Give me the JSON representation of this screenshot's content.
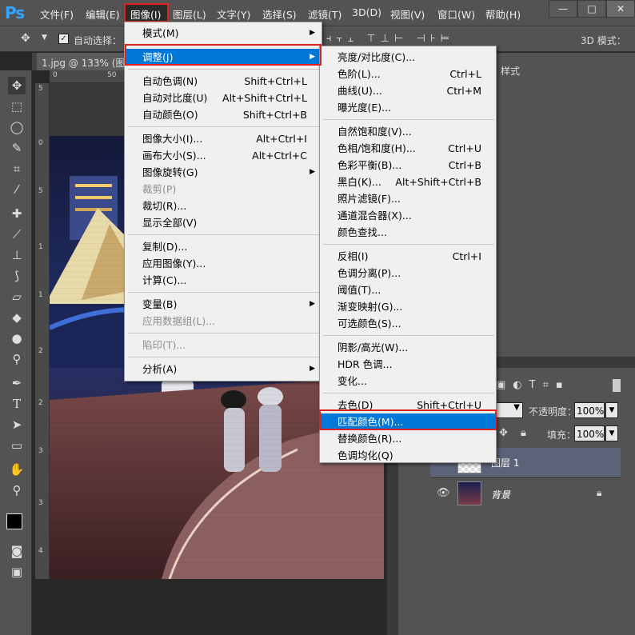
{
  "menubar": {
    "logo": "Ps",
    "items": [
      "文件(F)",
      "编辑(E)",
      "图像(I)",
      "图层(L)",
      "文字(Y)",
      "选择(S)",
      "滤镜(T)",
      "3D(D)",
      "视图(V)",
      "窗口(W)",
      "帮助(H)"
    ],
    "window_controls": [
      "—",
      "□",
      "✕"
    ]
  },
  "options": {
    "auto_select_label": "自动选择：",
    "mode_3d_label": "3D 模式："
  },
  "document": {
    "tab_title": "1.jpg @ 133% (图",
    "ruler_h": [
      "0",
      "50"
    ],
    "ruler_v": [
      "5",
      "0",
      "5",
      "1",
      "1",
      "2",
      "2",
      "3",
      "3",
      "4",
      "4"
    ]
  },
  "panels": {
    "style_tab": "样式",
    "opacity_label": "不透明度：",
    "opacity_value": "100%",
    "fill_label": "填充：",
    "fill_value": "100%",
    "layers": [
      {
        "name": "图层 1"
      },
      {
        "name": "背景"
      }
    ]
  },
  "image_menu": {
    "items": [
      {
        "label": "模式(M)",
        "shortcut": "",
        "submenu": true,
        "disabled": false
      },
      {
        "sep": true
      },
      {
        "label": "调整(J)",
        "shortcut": "",
        "submenu": true,
        "disabled": false,
        "highlighted": true
      },
      {
        "sep": true
      },
      {
        "label": "自动色调(N)",
        "shortcut": "Shift+Ctrl+L"
      },
      {
        "label": "自动对比度(U)",
        "shortcut": "Alt+Shift+Ctrl+L"
      },
      {
        "label": "自动颜色(O)",
        "shortcut": "Shift+Ctrl+B"
      },
      {
        "sep": true
      },
      {
        "label": "图像大小(I)...",
        "shortcut": "Alt+Ctrl+I"
      },
      {
        "label": "画布大小(S)...",
        "shortcut": "Alt+Ctrl+C"
      },
      {
        "label": "图像旋转(G)",
        "shortcut": "",
        "submenu": true
      },
      {
        "label": "裁剪(P)",
        "shortcut": "",
        "disabled": true
      },
      {
        "label": "裁切(R)...",
        "shortcut": ""
      },
      {
        "label": "显示全部(V)",
        "shortcut": ""
      },
      {
        "sep": true
      },
      {
        "label": "复制(D)...",
        "shortcut": ""
      },
      {
        "label": "应用图像(Y)...",
        "shortcut": ""
      },
      {
        "label": "计算(C)...",
        "shortcut": ""
      },
      {
        "sep": true
      },
      {
        "label": "变量(B)",
        "shortcut": "",
        "submenu": true
      },
      {
        "label": "应用数据组(L)...",
        "shortcut": "",
        "disabled": true
      },
      {
        "sep": true
      },
      {
        "label": "陷印(T)...",
        "shortcut": "",
        "disabled": true
      },
      {
        "sep": true
      },
      {
        "label": "分析(A)",
        "shortcut": "",
        "submenu": true
      }
    ]
  },
  "adjust_menu": {
    "items": [
      {
        "label": "亮度/对比度(C)...",
        "shortcut": ""
      },
      {
        "label": "色阶(L)...",
        "shortcut": "Ctrl+L"
      },
      {
        "label": "曲线(U)...",
        "shortcut": "Ctrl+M"
      },
      {
        "label": "曝光度(E)...",
        "shortcut": ""
      },
      {
        "sep": true
      },
      {
        "label": "自然饱和度(V)...",
        "shortcut": ""
      },
      {
        "label": "色相/饱和度(H)...",
        "shortcut": "Ctrl+U"
      },
      {
        "label": "色彩平衡(B)...",
        "shortcut": "Ctrl+B"
      },
      {
        "label": "黑白(K)...",
        "shortcut": "Alt+Shift+Ctrl+B"
      },
      {
        "label": "照片滤镜(F)...",
        "shortcut": ""
      },
      {
        "label": "通道混合器(X)...",
        "shortcut": ""
      },
      {
        "label": "颜色查找...",
        "shortcut": ""
      },
      {
        "sep": true
      },
      {
        "label": "反相(I)",
        "shortcut": "Ctrl+I"
      },
      {
        "label": "色调分离(P)...",
        "shortcut": ""
      },
      {
        "label": "阈值(T)...",
        "shortcut": ""
      },
      {
        "label": "渐变映射(G)...",
        "shortcut": ""
      },
      {
        "label": "可选颜色(S)...",
        "shortcut": ""
      },
      {
        "sep": true
      },
      {
        "label": "阴影/高光(W)...",
        "shortcut": ""
      },
      {
        "label": "HDR 色调...",
        "shortcut": ""
      },
      {
        "label": "变化...",
        "shortcut": ""
      },
      {
        "sep": true
      },
      {
        "label": "去色(D)",
        "shortcut": "Shift+Ctrl+U"
      },
      {
        "label": "匹配颜色(M)...",
        "shortcut": "",
        "highlighted": true
      },
      {
        "label": "替换颜色(R)...",
        "shortcut": ""
      },
      {
        "label": "色调均化(Q)",
        "shortcut": ""
      }
    ]
  },
  "colors": {
    "highlight": "#0078d7",
    "red_outline": "#e0221f"
  }
}
